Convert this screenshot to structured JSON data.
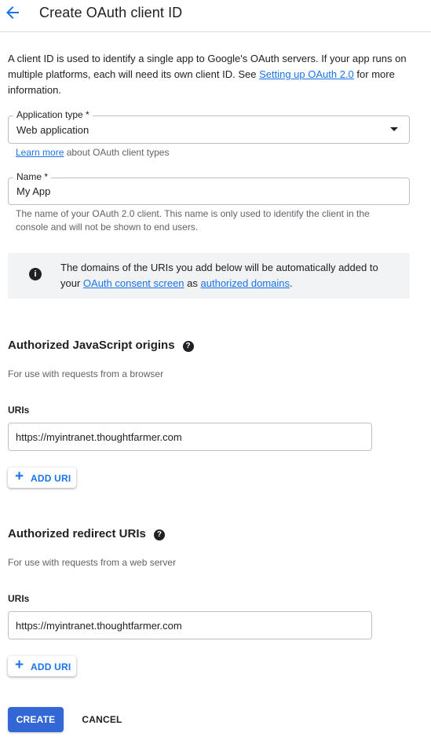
{
  "header": {
    "back_icon": "arrow-back-icon",
    "title": "Create OAuth client ID"
  },
  "intro": {
    "text_before": "A client ID is used to identify a single app to Google's OAuth servers. If your app runs on multiple platforms, each will need its own client ID. See ",
    "link": "Setting up OAuth 2.0",
    "text_after": " for more information."
  },
  "app_type": {
    "label": "Application type *",
    "value": "Web application",
    "hint_link": "Learn more",
    "hint_text": " about OAuth client types"
  },
  "name": {
    "label": "Name *",
    "value": "My App",
    "hint": "The name of your OAuth 2.0 client. This name is only used to identify the client in the console and will not be shown to end users."
  },
  "notice": {
    "icon": "info-icon",
    "text_before": "The domains of the URIs you add below will be automatically added to your ",
    "link1": "OAuth consent screen",
    "text_middle": " as ",
    "link2": "authorized domains",
    "text_after": "."
  },
  "js_origins": {
    "title": "Authorized JavaScript origins",
    "help_icon": "help-icon",
    "subtitle": "For use with requests from a browser",
    "uris_label": "URIs",
    "uri_value": "https://myintranet.thoughtfarmer.com",
    "add_label": "ADD URI"
  },
  "redirect_uris": {
    "title": "Authorized redirect URIs",
    "help_icon": "help-icon",
    "subtitle": "For use with requests from a web server",
    "uris_label": "URIs",
    "uri_value": "https://myintranet.thoughtfarmer.com",
    "add_label": "ADD URI"
  },
  "actions": {
    "create_label": "CREATE",
    "cancel_label": "CANCEL"
  },
  "colors": {
    "accent": "#1a73e8",
    "primary_button": "#3367d6",
    "notice_bg": "#f1f3f4"
  }
}
